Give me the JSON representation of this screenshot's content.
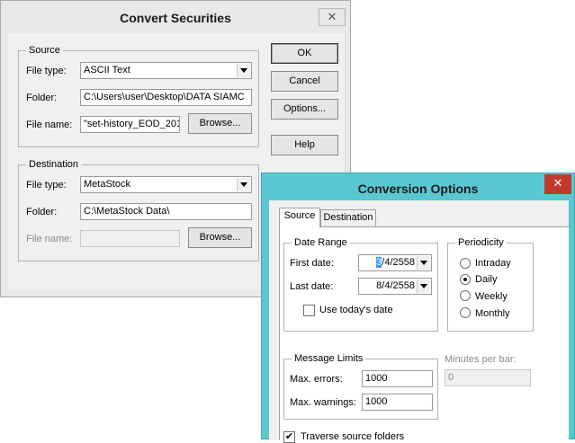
{
  "convert": {
    "title": "Convert Securities",
    "source": {
      "legend": "Source",
      "file_type_label": "File type:",
      "file_type_value": "ASCII Text",
      "folder_label": "Folder:",
      "folder_value": "C:\\Users\\user\\Desktop\\DATA  SIAMC",
      "file_name_label": "File name:",
      "file_name_value": "\"set-history_EOD_201",
      "browse_label": "Browse..."
    },
    "destination": {
      "legend": "Destination",
      "file_type_label": "File type:",
      "file_type_value": "MetaStock",
      "folder_label": "Folder:",
      "folder_value": "C:\\MetaStock Data\\",
      "file_name_label": "File name:",
      "file_name_value": "",
      "browse_label": "Browse..."
    },
    "buttons": {
      "ok": "OK",
      "cancel": "Cancel",
      "options": "Options...",
      "help": "Help"
    },
    "close_glyph": "✕"
  },
  "options": {
    "title": "Conversion Options",
    "close_glyph": "✕",
    "tabs": [
      {
        "label": "Source",
        "active": true
      },
      {
        "label": "Destination",
        "active": false
      }
    ],
    "date_range": {
      "legend": "Date Range",
      "first_label": "First date:",
      "first_value": "3/4/2558",
      "first_highlight": "3",
      "first_rest": "/4/2558",
      "last_label": "Last date:",
      "last_value": "8/4/2558",
      "use_today_label": "Use today's date",
      "use_today_checked": false
    },
    "periodicity": {
      "legend": "Periodicity",
      "items": [
        {
          "label": "Intraday",
          "selected": false
        },
        {
          "label": "Daily",
          "selected": true
        },
        {
          "label": "Weekly",
          "selected": false
        },
        {
          "label": "Monthly",
          "selected": false
        }
      ]
    },
    "message_limits": {
      "legend": "Message Limits",
      "max_errors_label": "Max. errors:",
      "max_errors_value": "1000",
      "max_warnings_label": "Max. warnings:",
      "max_warnings_value": "1000"
    },
    "minutes_per_bar": {
      "label": "Minutes per bar:",
      "value": "0"
    },
    "traverse": {
      "label": "Traverse source folders",
      "checked": true,
      "check_glyph": "✔"
    }
  },
  "colors": {
    "convert_frame": "#e8e8e8",
    "options_frame": "#5ac8d2",
    "close_red": "#c0392b",
    "dialog_bg": "#f0f0f0"
  }
}
